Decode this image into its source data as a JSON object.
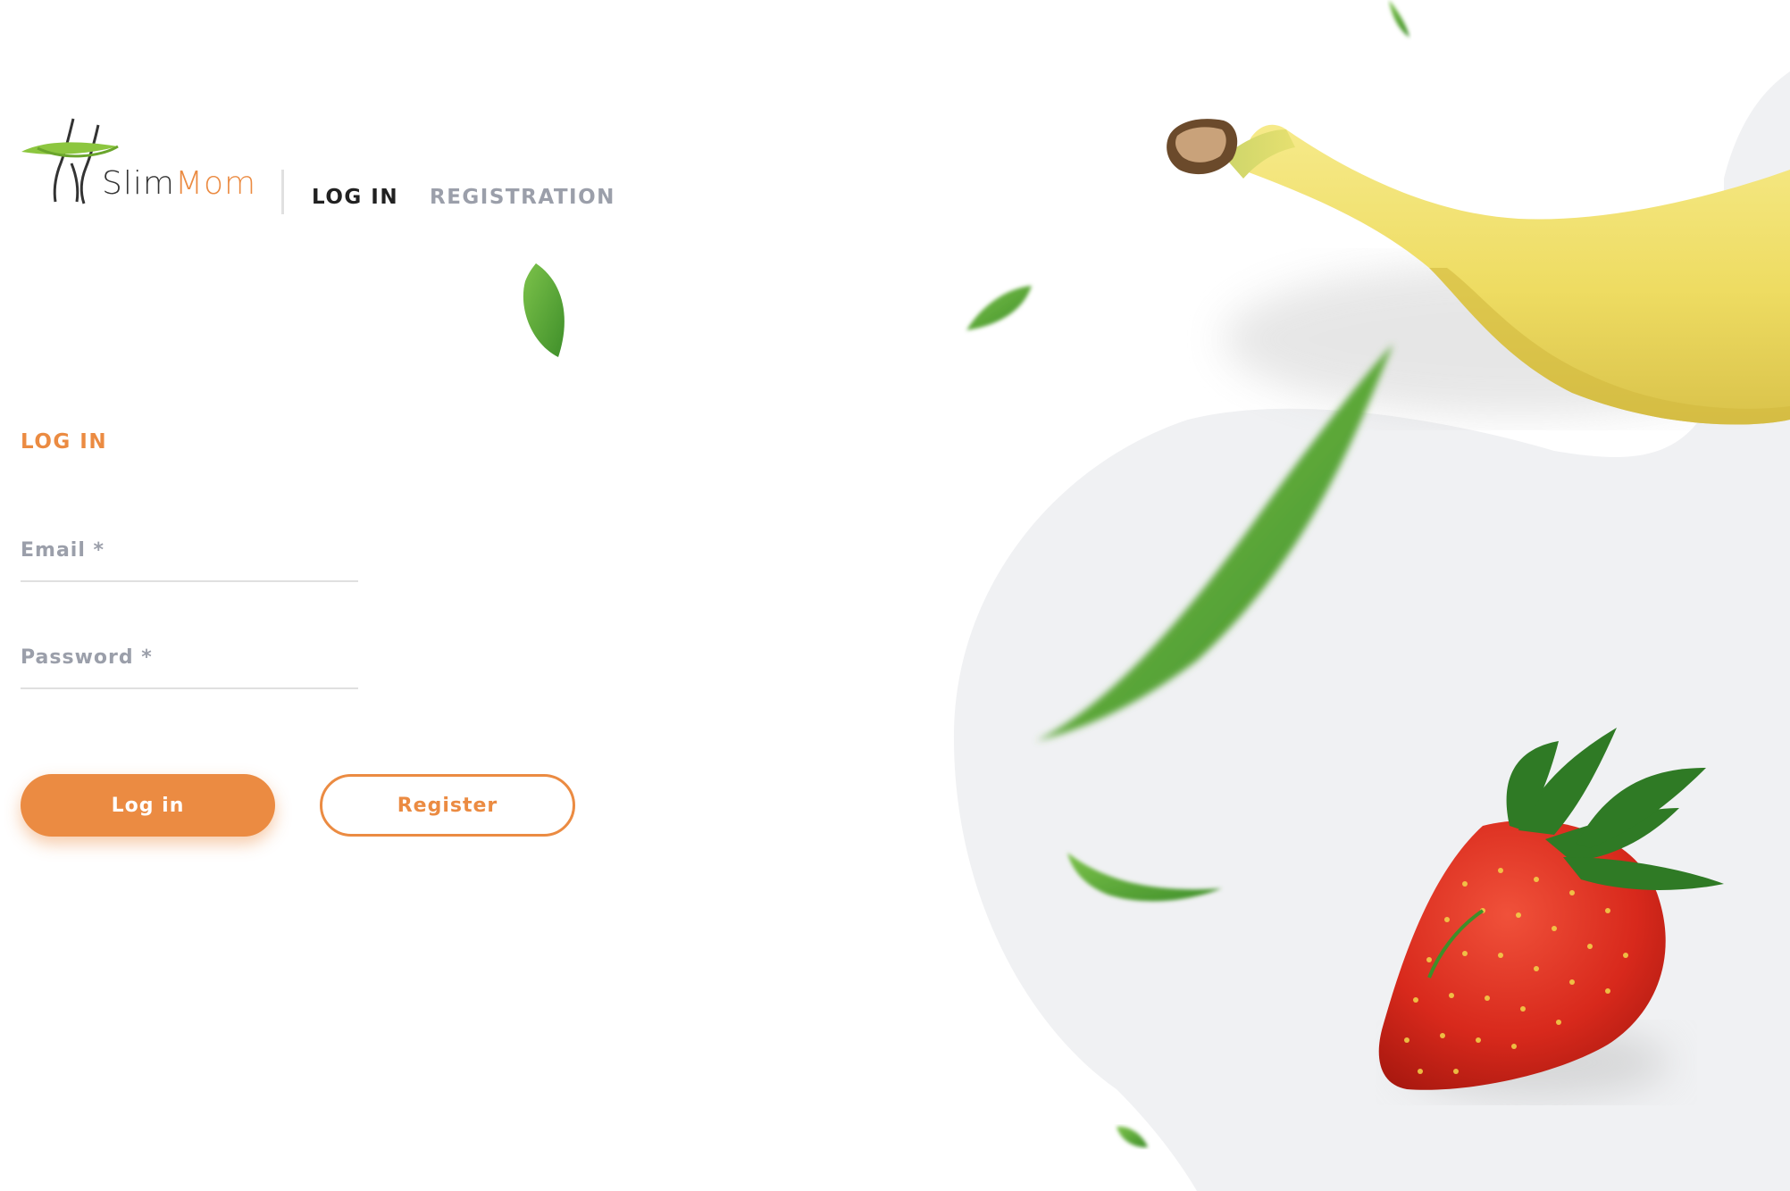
{
  "brand": {
    "name_part1": "Slim",
    "name_part2": "Mom",
    "accent_color": "#eb8b42",
    "logo_icon": "waist-measuring-tape-icon"
  },
  "nav": {
    "login_label": "LOG IN",
    "registration_label": "REGISTRATION",
    "active": "LOG IN"
  },
  "form": {
    "title": "LOG IN",
    "email_placeholder": "Email *",
    "email_value": "",
    "password_placeholder": "Password *",
    "password_value": "",
    "login_button_label": "Log in",
    "register_button_label": "Register"
  },
  "colors": {
    "primary": "#eb8b42",
    "text_dark": "#212121",
    "text_muted": "#9b9faa",
    "blob_bg": "#f0f1f3"
  },
  "decorations": [
    "banana-image",
    "strawberry-image",
    "leaf-icon"
  ]
}
